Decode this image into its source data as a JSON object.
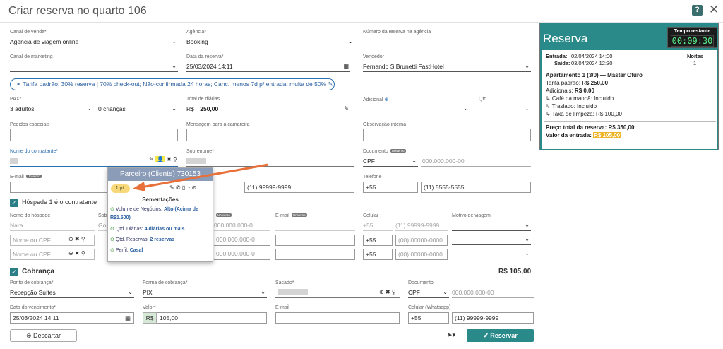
{
  "title": "Criar reserva no quarto 106",
  "help": "?",
  "close": "✕",
  "canal_venda": {
    "label": "Canal de venda*",
    "value": "Agência de viagem online"
  },
  "agencia": {
    "label": "Agência*",
    "value": "Booking"
  },
  "numero_reserva": {
    "label": "Número da reserva na agência"
  },
  "canal_marketing": {
    "label": "Canal de marketing"
  },
  "data_reserva": {
    "label": "Data da reserva*",
    "value": "25/03/2024 14:11"
  },
  "vendedor": {
    "label": "Vendedor",
    "value": "Fernando S Brunetti FastHotel"
  },
  "tariff": "Tarifa padrão: 30% reserva | 70% check-out; Não-confirmada 24 horas; Canc. menos 7d p/ entrada: multa de 50%",
  "pax": {
    "label": "PAX*",
    "adults": "3 adultos",
    "children": "0 crianças"
  },
  "total_diarias": {
    "label": "Total de diárias",
    "currency": "R$",
    "value": "250,00"
  },
  "adicional": {
    "label": "Adicional"
  },
  "qtd": {
    "label": "Qtd."
  },
  "pedidos": {
    "label": "Pedidos especiais"
  },
  "mensagem": {
    "label": "Mensagem para a camareira"
  },
  "observacao": {
    "label": "Observação interna"
  },
  "nome_contratante": {
    "label": "Nome do contratante*"
  },
  "sobrenome": {
    "label": "Sobrenome*"
  },
  "documento": {
    "label": "Documento",
    "badge": "Universo",
    "type": "CPF",
    "placeholder": "000.000.000-00"
  },
  "email": {
    "label": "E-mail",
    "badge": "Universo"
  },
  "celular_contratante": "(11) 99999-9999",
  "telefone": {
    "label": "Telefone",
    "ddi": "+55",
    "value": "(11) 5555-5555"
  },
  "hospede_check": "Hóspede 1 é o contratante",
  "hospedes": {
    "headers": {
      "nome": "Nome do hóspede",
      "sobrenome": "Sob",
      "documento_badge": "Universo",
      "email": "E-mail",
      "email_badge": "Universo",
      "celular": "Celular",
      "motivo": "Motivo de viagem"
    },
    "row1": {
      "nome": "Nara",
      "sobrenome": "Go",
      "doc": "000.000.000-0",
      "ddi": "+55",
      "cel": "(11) 99999-9999"
    },
    "row_placeholder": "Nome ou CPF",
    "doc_ph": "000.000.000-0",
    "ddi": "+55",
    "cel_ph": "(00) 00000-0000"
  },
  "cobranca": {
    "label": "Cobrança",
    "total": "R$ 105,00"
  },
  "ponto_cobranca": {
    "label": "Ponto de cobrança*",
    "value": "Recepção Suítes"
  },
  "forma_cobranca": {
    "label": "Forma de cobrança*",
    "value": "PIX"
  },
  "sacado": {
    "label": "Sacado*"
  },
  "doc_cobranca": {
    "label": "Documento",
    "type": "CPF",
    "placeholder": "000.000.000-00"
  },
  "vencimento": {
    "label": "Data do vencimento*",
    "value": "25/03/2024 14:11"
  },
  "valor": {
    "label": "Valor*",
    "currency": "R$",
    "value": "105,00"
  },
  "email_cobranca": {
    "label": "E-mail"
  },
  "celular_whatsapp": {
    "label": "Celular (Whatsapp)",
    "ddi": "+55",
    "value": "(11) 99999-9999"
  },
  "descartar": "Descartar",
  "reservar": "Reservar",
  "reserva_panel": {
    "title": "Reserva",
    "timer_label": "Tempo restante",
    "timer_value": "00:09:30",
    "entrada_label": "Entrada:",
    "entrada_value": "02/04/2024 14:00",
    "saida_label": "Saída:",
    "saida_value": "03/04/2024 12:30",
    "noites_label": "Noites",
    "noites_value": "1",
    "apt": "Apartamento 1 (3/0) — Master Ofurô",
    "tarifa_label": "Tarifa padrão:",
    "tarifa_value": "R$ 250,00",
    "adicionais_label": "Adicionais:",
    "adicionais_value": "R$ 0,00",
    "cafe": "↳ Café da manhã: Incluído",
    "traslado": "↳ Traslado: Incluído",
    "taxa": "↳ Taxa de limpeza: R$ 100,00",
    "preco_label": "Preço total da reserva:",
    "preco_value": "R$ 350,00",
    "entrada_valor_label": "Valor da entrada:",
    "entrada_valor_value": "R$ 105,00"
  },
  "popup": {
    "title": "Parceiro (Cliente) 730153",
    "points": "1 pt.",
    "section": "Sementações",
    "items": [
      {
        "label": "Volume de Negócios:",
        "value": "Alto (Acima de",
        "value2": "R$1.500)"
      },
      {
        "label": "Qtd. Diárias:",
        "value": "4 diárias ou mais"
      },
      {
        "label": "Qtd. Reservas:",
        "value": "2 reservas"
      },
      {
        "label": "Perfil:",
        "value": "Casal"
      }
    ]
  },
  "colors": {
    "accent": "#2a8a8a",
    "highlight": "#f0b429",
    "arrow": "#e8703a"
  }
}
